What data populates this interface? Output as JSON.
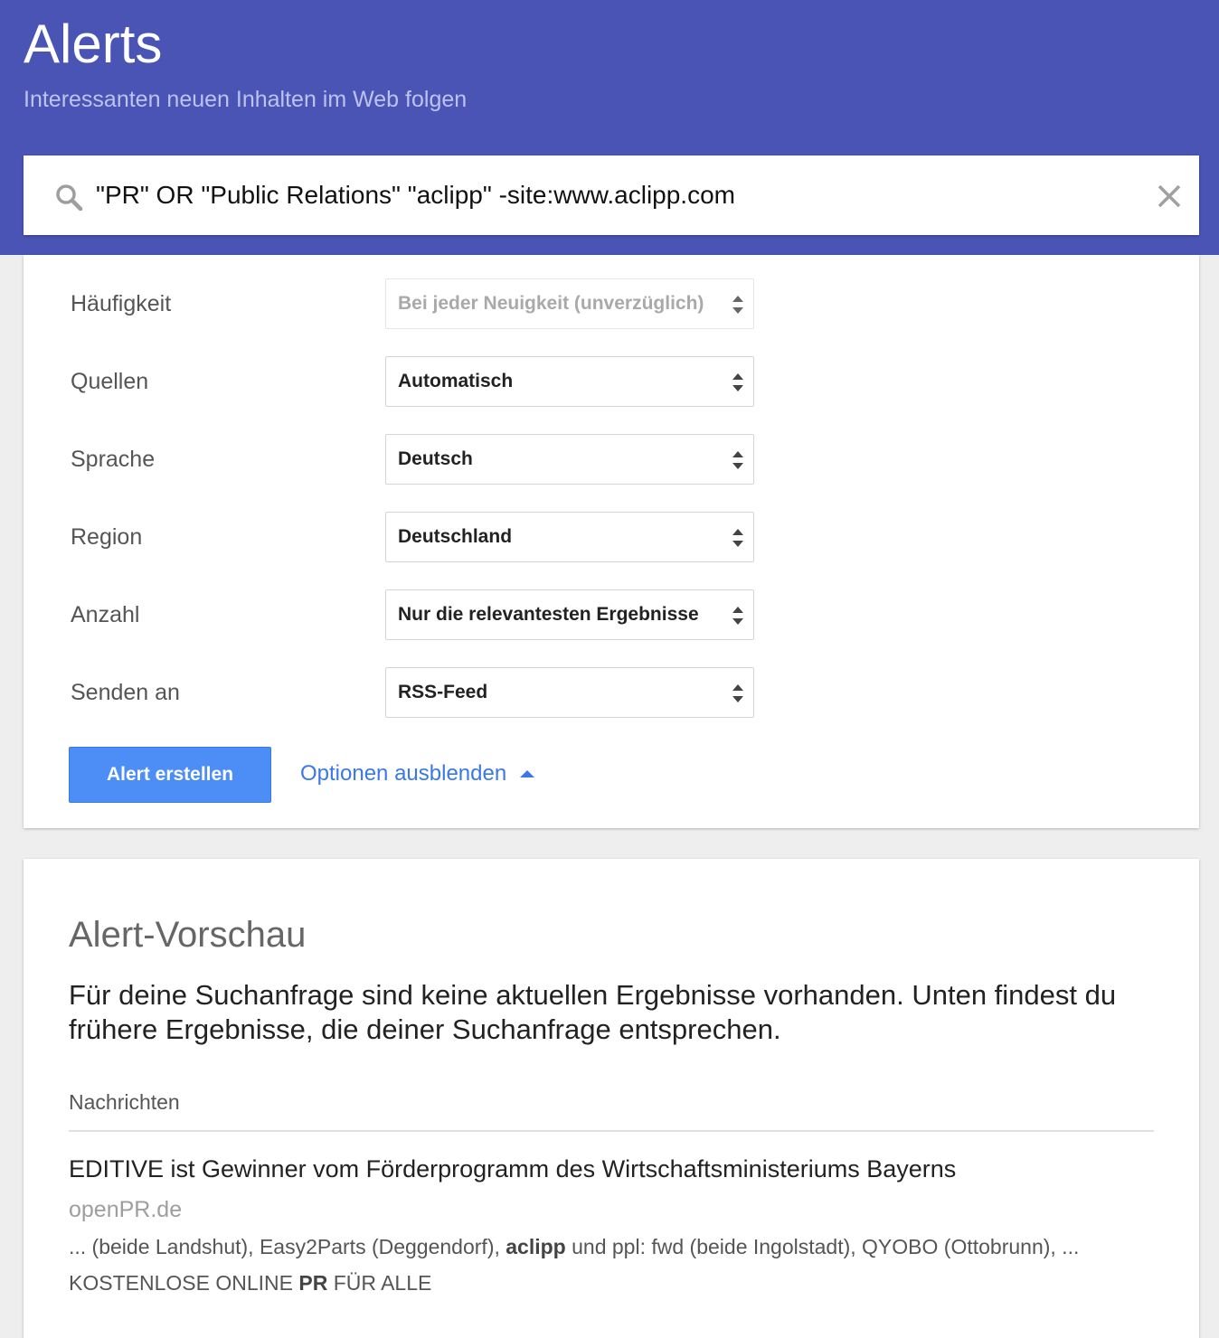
{
  "header": {
    "title": "Alerts",
    "subtitle": "Interessanten neuen Inhalten im Web folgen"
  },
  "search": {
    "query": "\"PR\" OR \"Public Relations\" \"aclipp\" -site:www.aclipp.com",
    "icon": "search-icon",
    "clear_icon": "close-icon"
  },
  "options": [
    {
      "label": "Häufigkeit",
      "value": "Bei jeder Neuigkeit (unverzüglich)",
      "disabled": true
    },
    {
      "label": "Quellen",
      "value": "Automatisch",
      "disabled": false
    },
    {
      "label": "Sprache",
      "value": "Deutsch",
      "disabled": false
    },
    {
      "label": "Region",
      "value": "Deutschland",
      "disabled": false
    },
    {
      "label": "Anzahl",
      "value": "Nur die relevantesten Ergebnisse",
      "disabled": false
    },
    {
      "label": "Senden an",
      "value": "RSS-Feed",
      "disabled": false
    }
  ],
  "actions": {
    "create_label": "Alert erstellen",
    "hide_options_label": "Optionen ausblenden"
  },
  "preview": {
    "title": "Alert-Vorschau",
    "message": "Für deine Suchanfrage sind keine aktuellen Ergebnisse vorhanden. Unten findest du frühere Ergebnisse, die deiner Suchanfrage entsprechen.",
    "section_label": "Nachrichten",
    "results": [
      {
        "title": "EDITIVE ist Gewinner vom Förderprogramm des Wirtschaftsministeriums Bayerns",
        "source": "openPR.de",
        "snippet_before": "... (beide Landshut), Easy2Parts (Deggendorf), ",
        "snippet_bold": "aclipp",
        "snippet_after": " und ppl: fwd (beide Ingolstadt), QYOBO (Ottobrunn), ...",
        "tag_before": "KOSTENLOSE ONLINE ",
        "tag_bold": "PR",
        "tag_after": " FÜR ALLE"
      }
    ]
  },
  "colors": {
    "header_bg": "#4a54b4",
    "primary_button": "#4d8ef6",
    "link": "#3b78e7"
  }
}
